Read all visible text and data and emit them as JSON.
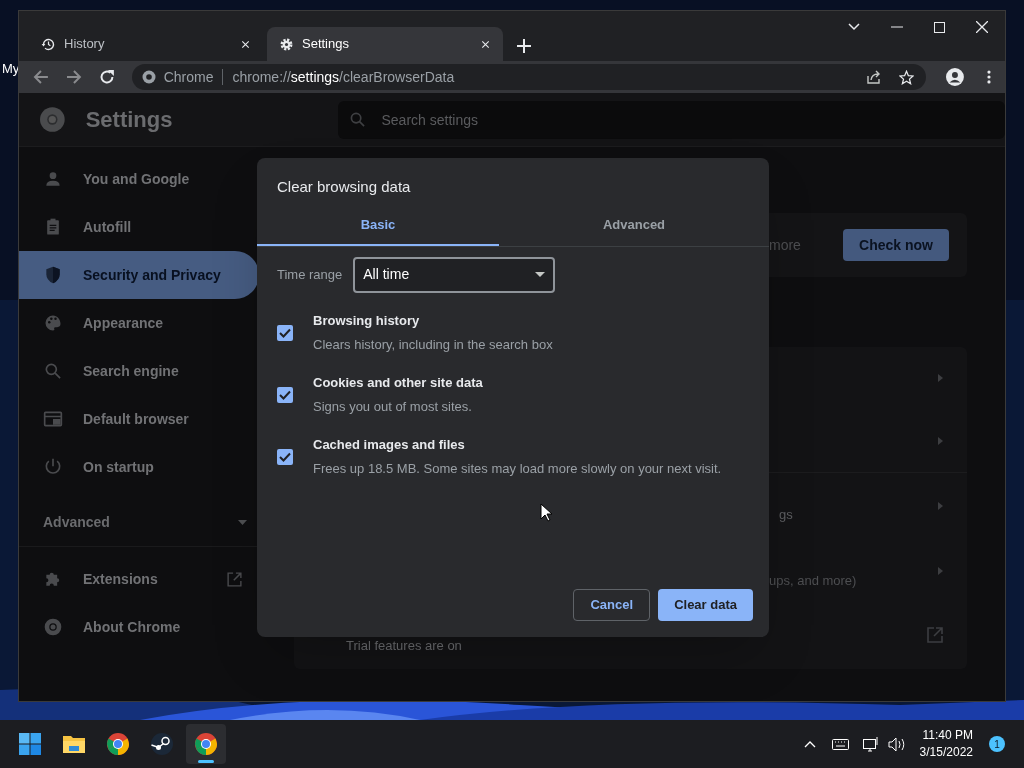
{
  "desktop": {
    "fragment": "My"
  },
  "browser": {
    "tabs": [
      {
        "title": "History",
        "selected": false
      },
      {
        "title": "Settings",
        "selected": true
      }
    ],
    "address": {
      "origin": "Chrome",
      "url": "chrome://**settings**/clearBrowserData"
    }
  },
  "settings": {
    "title": "Settings",
    "search": {
      "placeholder": "Search settings"
    },
    "sidebar": {
      "items": [
        {
          "label": "You and Google",
          "selected": false
        },
        {
          "label": "Autofill",
          "selected": false
        },
        {
          "label": "Security and Privacy",
          "selected": true
        },
        {
          "label": "Appearance",
          "selected": false
        },
        {
          "label": "Search engine",
          "selected": false
        },
        {
          "label": "Default browser",
          "selected": false
        },
        {
          "label": "On startup",
          "selected": false
        }
      ],
      "advanced": {
        "label": "Advanced",
        "expanded": false
      },
      "bottom_items": [
        {
          "label": "Extensions",
          "external": true
        },
        {
          "label": "About Chrome",
          "external": false
        }
      ]
    },
    "background": {
      "check_fragment": "more",
      "check_button": "Check now",
      "row_fragments": [
        "gs",
        "ups, and more)"
      ],
      "trial_text": "Trial features are on"
    }
  },
  "dialog": {
    "title": "Clear browsing data",
    "tabs": [
      {
        "label": "Basic",
        "selected": true
      },
      {
        "label": "Advanced",
        "selected": false
      }
    ],
    "time_range": {
      "label": "Time range",
      "value": "All time"
    },
    "options": [
      {
        "title": "Browsing history",
        "description": "Clears history, including in the search box",
        "checked": true
      },
      {
        "title": "Cookies and other site data",
        "description": "Signs you out of most sites.",
        "checked": true
      },
      {
        "title": "Cached images and files",
        "description": "Frees up 18.5 MB. Some sites may load more slowly on your next visit.",
        "checked": true
      }
    ],
    "buttons": [
      {
        "label": "Cancel",
        "kind": "secondary"
      },
      {
        "label": "Clear data",
        "kind": "primary"
      }
    ]
  },
  "taskbar": {
    "apps": [
      {
        "active": false
      },
      {
        "active": false
      },
      {
        "active": false
      },
      {
        "active": false
      },
      {
        "active": true
      }
    ],
    "time": "11:40 PM",
    "date": "3/15/2022",
    "notifications": "1"
  }
}
